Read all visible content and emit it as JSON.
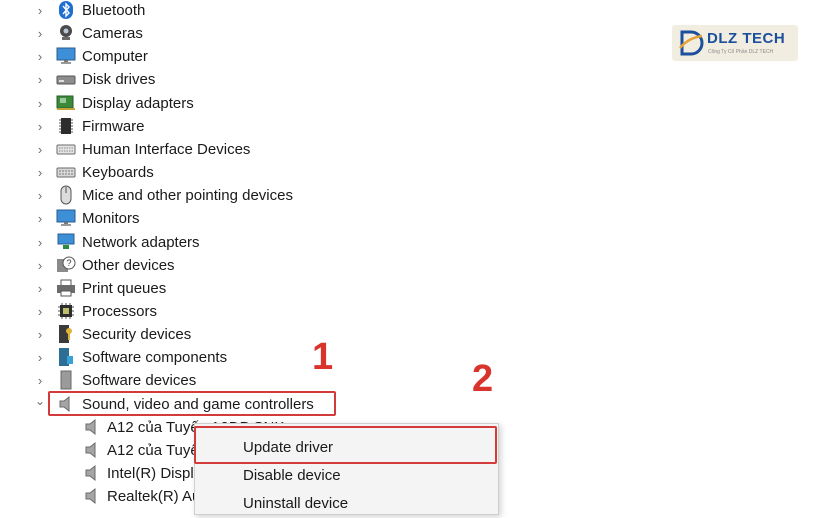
{
  "categories": [
    {
      "label": "Bluetooth",
      "icon": "bluetooth-icon"
    },
    {
      "label": "Cameras",
      "icon": "camera-icon"
    },
    {
      "label": "Computer",
      "icon": "monitor-icon"
    },
    {
      "label": "Disk drives",
      "icon": "disk-drive-icon"
    },
    {
      "label": "Display adapters",
      "icon": "display-adapter-icon"
    },
    {
      "label": "Firmware",
      "icon": "firmware-chip-icon"
    },
    {
      "label": "Human Interface Devices",
      "icon": "hid-keyboard-icon"
    },
    {
      "label": "Keyboards",
      "icon": "keyboard-icon"
    },
    {
      "label": "Mice and other pointing devices",
      "icon": "mouse-icon"
    },
    {
      "label": "Monitors",
      "icon": "monitor-icon"
    },
    {
      "label": "Network adapters",
      "icon": "network-adapter-icon"
    },
    {
      "label": "Other devices",
      "icon": "unknown-device-icon"
    },
    {
      "label": "Print queues",
      "icon": "printer-icon"
    },
    {
      "label": "Processors",
      "icon": "processor-icon"
    },
    {
      "label": "Security devices",
      "icon": "security-device-icon"
    },
    {
      "label": "Software components",
      "icon": "software-component-icon"
    },
    {
      "label": "Software devices",
      "icon": "software-device-icon"
    },
    {
      "label": "Sound, video and game controllers",
      "icon": "speaker-icon",
      "expanded": true
    }
  ],
  "children": [
    {
      "label": "A12 của Tuyến A2DP SNK",
      "icon": "speaker-icon"
    },
    {
      "label": "A12 của Tuyế",
      "icon": "speaker-icon"
    },
    {
      "label": "Intel(R) Displa",
      "icon": "speaker-icon"
    },
    {
      "label": "Realtek(R) Au",
      "icon": "speaker-icon"
    }
  ],
  "context_menu": {
    "items": [
      "Update driver",
      "Disable device",
      "Uninstall device"
    ]
  },
  "annotations": {
    "step1": "1",
    "step2": "2",
    "color": "#d33a3a"
  },
  "logo": {
    "name": "DLZ TECH",
    "tagline": "Công Ty Cổ Phần DLZ TECH"
  }
}
